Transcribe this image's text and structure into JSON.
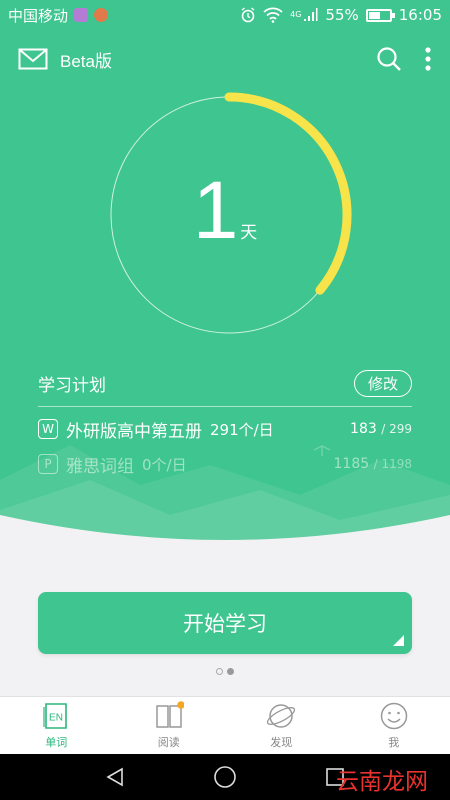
{
  "status": {
    "carrier": "中国移动",
    "network": "4G",
    "battery": "55%",
    "battery_level": 0.55,
    "time": "16:05"
  },
  "topbar": {
    "title": "Beta版",
    "icons": [
      "mail-icon",
      "search-icon",
      "more-vertical-icon"
    ]
  },
  "progress": {
    "days": "1",
    "unit": "天",
    "ring_fraction": 0.36,
    "ring_color": "#f7e34a"
  },
  "plan": {
    "label": "学习计划",
    "edit_label": "修改",
    "books": [
      {
        "tag": "W",
        "name": "外研版高中第五册",
        "rate": "291个/日",
        "done": "183",
        "total": "/ 299"
      },
      {
        "tag": "P",
        "name": "雅思词组",
        "rate": "0个/日",
        "done": "1185",
        "total": "/ 1198"
      }
    ]
  },
  "start_label": "开始学习",
  "pager": {
    "count": 2,
    "active": 1
  },
  "tabs": [
    {
      "label": "单词",
      "icon": "en-word-icon",
      "active": true
    },
    {
      "label": "阅读",
      "icon": "book-icon",
      "active": false,
      "badge": true
    },
    {
      "label": "发现",
      "icon": "planet-icon",
      "active": false
    },
    {
      "label": "我",
      "icon": "smile-face-icon",
      "active": false
    }
  ],
  "tab_icon_text": "EN",
  "watermark": "云南龙网",
  "colors": {
    "brand": "#3fc58f",
    "accent": "#f7e34a",
    "tab_active": "#2bb57c",
    "badge": "#f5a623"
  }
}
